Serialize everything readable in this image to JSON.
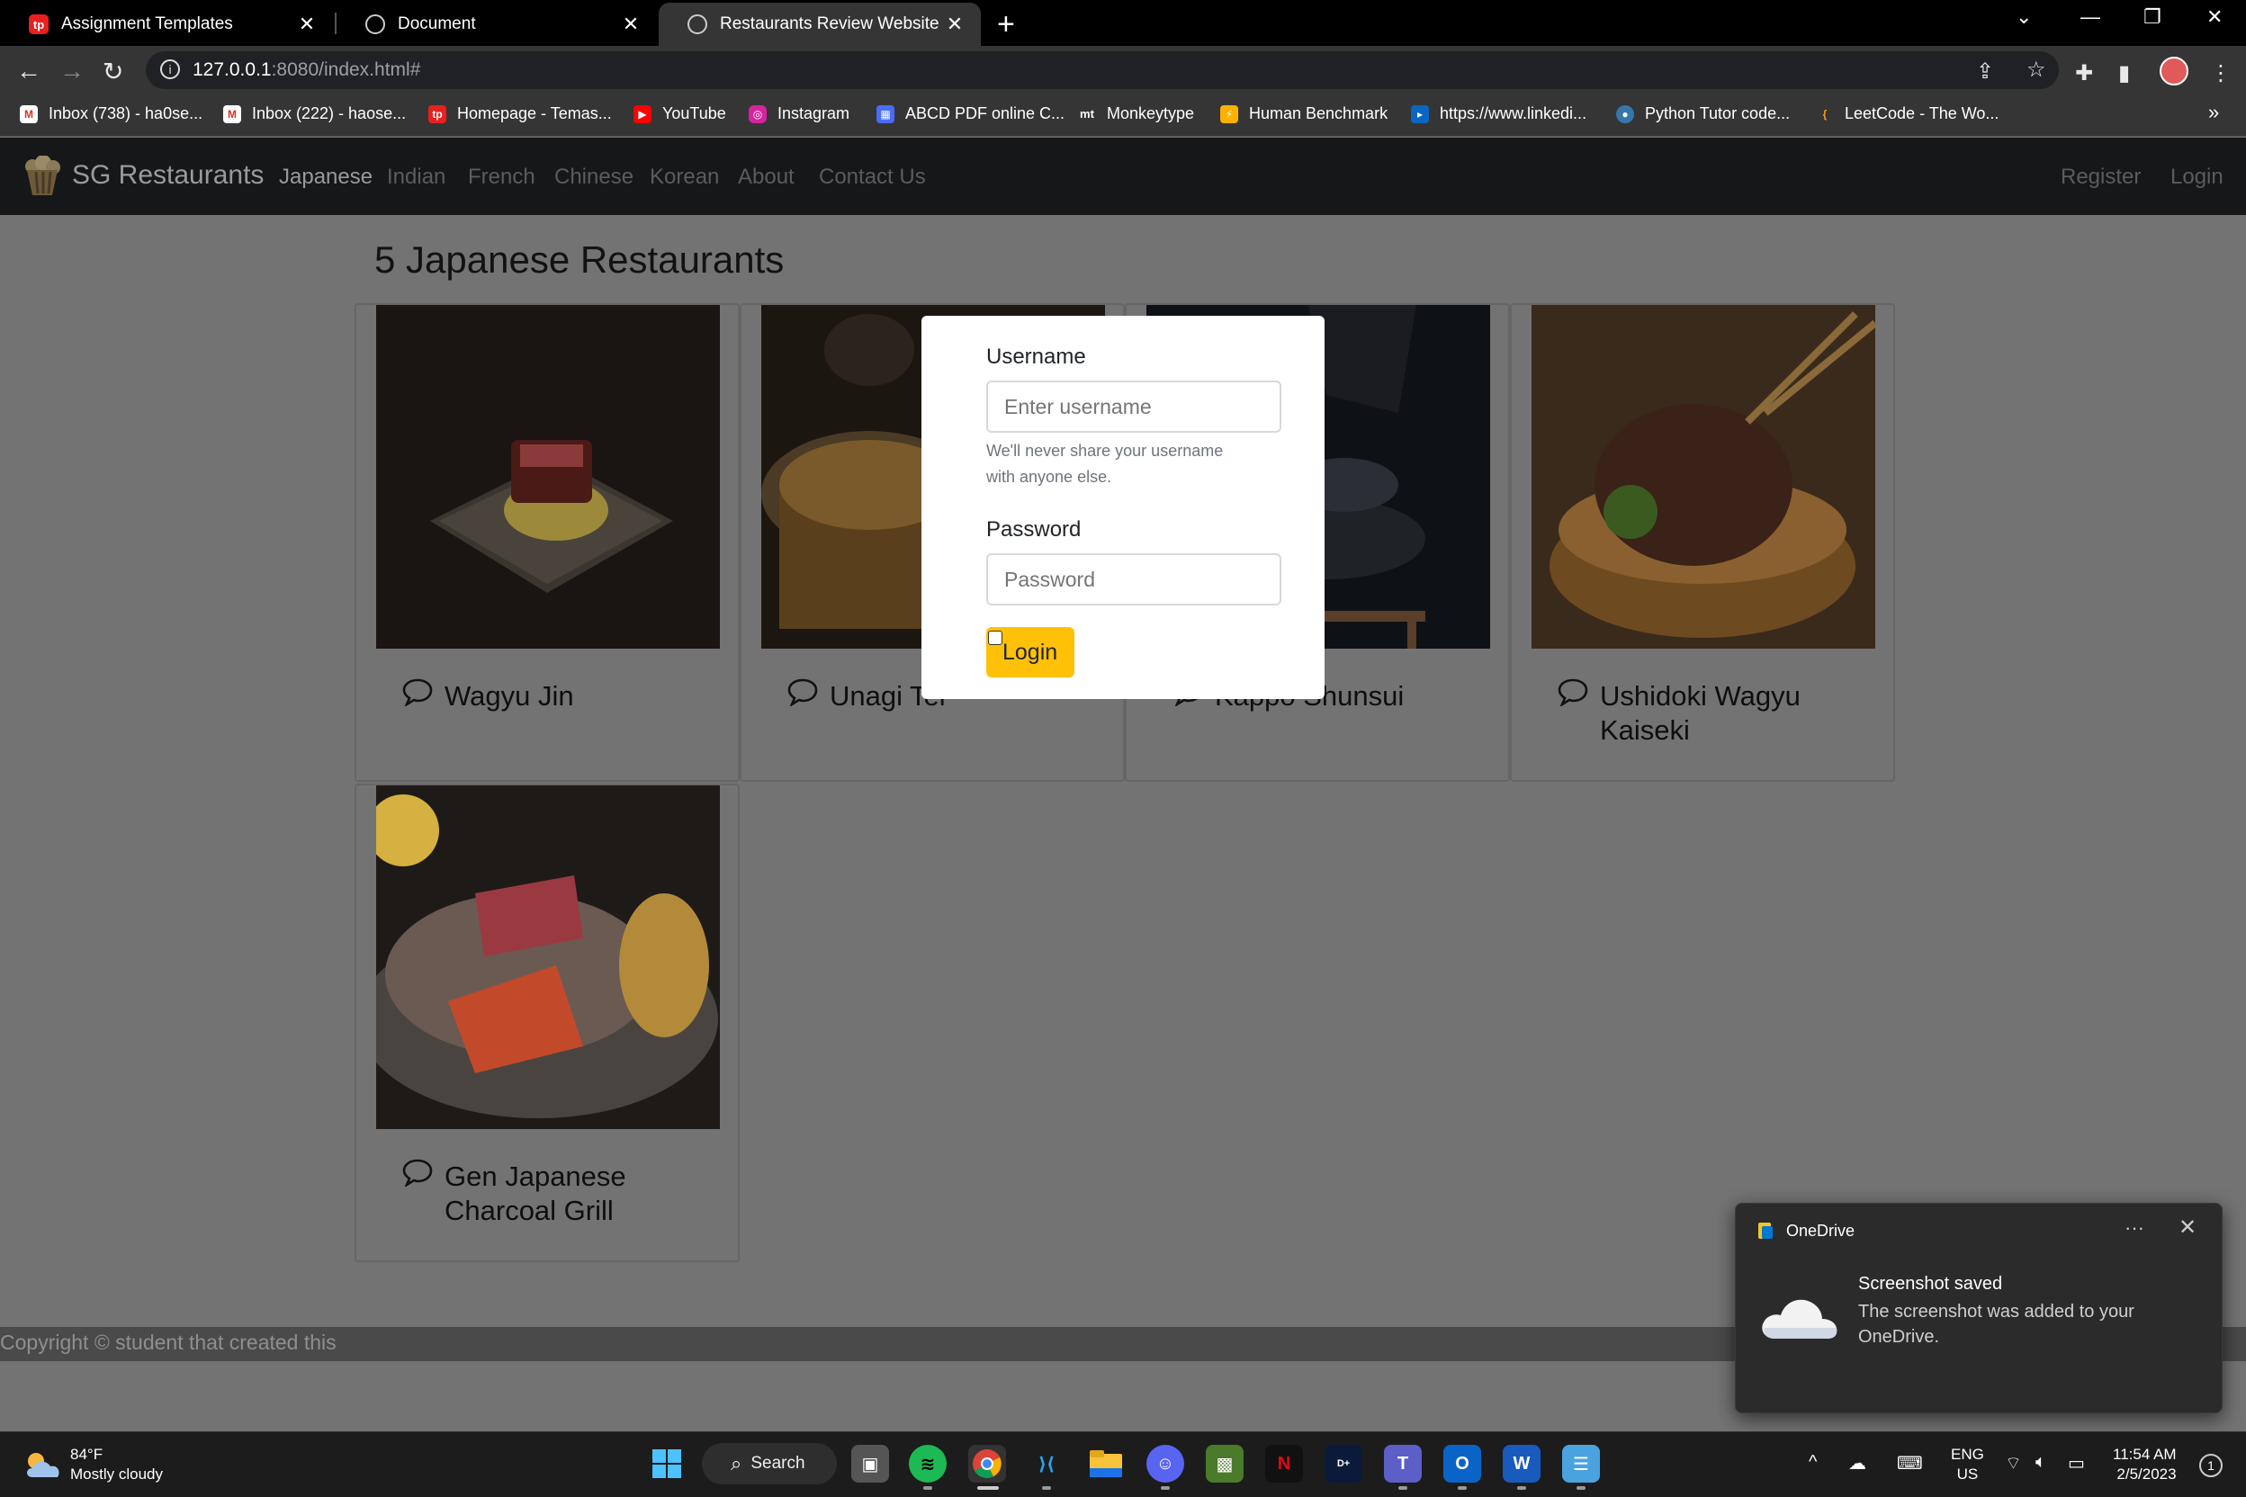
{
  "browser": {
    "tabs": [
      {
        "title": "Assignment Templates",
        "icon": "tp-logo-icon",
        "active": false
      },
      {
        "title": "Document",
        "icon": "globe-icon",
        "active": false
      },
      {
        "title": "Restaurants Review Website",
        "icon": "globe-icon",
        "active": true
      }
    ],
    "url_host": "127.0.0.1",
    "url_rest": ":8080/index.html#",
    "bookmarks": [
      {
        "label": "Inbox (738) - ha0se...",
        "icon": "gmail-icon"
      },
      {
        "label": "Inbox (222) - haose...",
        "icon": "gmail-icon"
      },
      {
        "label": "Homepage - Temas...",
        "icon": "tp-logo-icon"
      },
      {
        "label": "YouTube",
        "icon": "youtube-icon"
      },
      {
        "label": "Instagram",
        "icon": "instagram-icon"
      },
      {
        "label": "ABCD PDF online C...",
        "icon": "pdf-icon"
      },
      {
        "label": "Monkeytype",
        "icon": "monkeytype-icon"
      },
      {
        "label": "Human Benchmark",
        "icon": "lightning-icon"
      },
      {
        "label": "https://www.linkedi...",
        "icon": "linkedin-icon"
      },
      {
        "label": "Python Tutor code...",
        "icon": "python-icon"
      },
      {
        "label": "LeetCode - The Wo...",
        "icon": "leetcode-icon"
      }
    ]
  },
  "site": {
    "brand": "SG Restaurants",
    "nav": [
      "Japanese",
      "Indian",
      "French",
      "Chinese",
      "Korean",
      "About",
      "Contact Us"
    ],
    "nav_right": [
      "Register",
      "Login"
    ],
    "heading": "5 Japanese Restaurants",
    "restaurants": [
      {
        "name_line1": "Wagyu Jin",
        "name_line2": ""
      },
      {
        "name_line1": "Unagi Tei",
        "name_line2": ""
      },
      {
        "name_line1": "Kappo Shunsui",
        "name_line2": ""
      },
      {
        "name_line1": "Ushidoki Wagyu",
        "name_line2": "Kaiseki"
      },
      {
        "name_line1": "Gen Japanese",
        "name_line2": "Charcoal Grill"
      }
    ],
    "footer": "Copyright © student that created this"
  },
  "login_modal": {
    "username_label": "Username",
    "username_placeholder": "Enter username",
    "help_text": "We'll never share your username with anyone else.",
    "password_label": "Password",
    "password_placeholder": "Password",
    "login_button": "Login"
  },
  "toast": {
    "app": "OneDrive",
    "title": "Screenshot saved",
    "body": "The screenshot was added to your OneDrive."
  },
  "taskbar": {
    "weather_temp": "84°F",
    "weather_desc": "Mostly cloudy",
    "search_label": "Search",
    "lang_line1": "ENG",
    "lang_line2": "US",
    "time": "11:54 AM",
    "date": "2/5/2023"
  },
  "colors": {
    "accent_yellow": "#ffc107",
    "navbar_dark": "#151719"
  }
}
